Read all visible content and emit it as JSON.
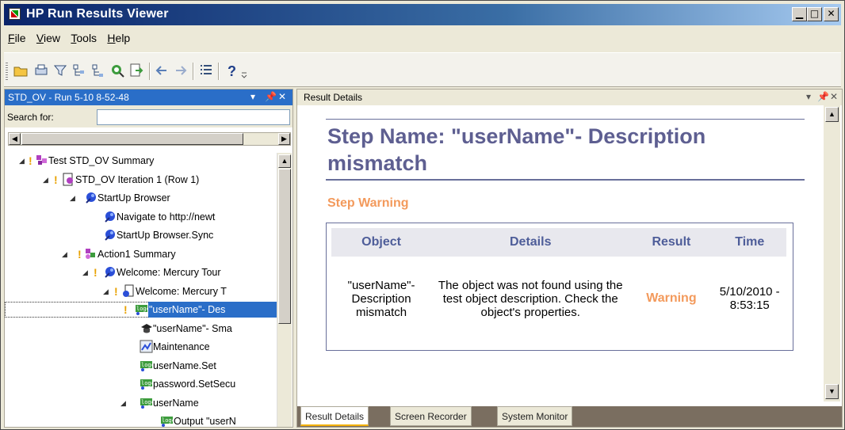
{
  "window": {
    "title": "HP Run Results Viewer",
    "controls": [
      "minimize-icon",
      "maximize-icon",
      "close-icon"
    ]
  },
  "menu": [
    "File",
    "View",
    "Tools",
    "Help"
  ],
  "toolbar": {
    "icons": [
      "open-icon",
      "print-icon",
      "filter-icon",
      "collapse-icon",
      "expand-icon",
      "find-icon",
      "export-icon",
      "back-icon",
      "forward-icon",
      "details-icon",
      "help-icon"
    ]
  },
  "left_pane": {
    "title": "STD_OV - Run 5-10 8-52-48",
    "search_label": "Search for:",
    "search_value": "",
    "tree": [
      {
        "label": "Test STD_OV Summary",
        "icon": "test-summary-icon",
        "expander": "open",
        "warning": true
      },
      {
        "label": "STD_OV Iteration 1 (Row 1)",
        "icon": "iteration-icon",
        "expander": "open",
        "warning": true
      },
      {
        "label": "StartUp Browser",
        "icon": "browser-icon",
        "expander": "open",
        "warning": false
      },
      {
        "label": "Navigate to http://newt",
        "icon": "browser-icon",
        "expander": "",
        "warning": false
      },
      {
        "label": "StartUp Browser.Sync",
        "icon": "browser-icon",
        "expander": "",
        "warning": false
      },
      {
        "label": "Action1 Summary",
        "icon": "action-icon",
        "expander": "open",
        "warning": true
      },
      {
        "label": "Welcome: Mercury Tour",
        "icon": "browser-icon",
        "expander": "open",
        "warning": true
      },
      {
        "label": "Welcome: Mercury T",
        "icon": "page-icon",
        "expander": "open",
        "warning": true
      },
      {
        "label": "\"userName\"- Des",
        "icon": "logic-icon",
        "expander": "",
        "warning": true,
        "selected": true
      },
      {
        "label": "\"userName\"- Sma",
        "icon": "smart-id-icon",
        "expander": "",
        "warning": false
      },
      {
        "label": "Maintenance",
        "icon": "maintenance-icon",
        "expander": "",
        "warning": false
      },
      {
        "label": "userName.Set",
        "icon": "logic-icon",
        "expander": "",
        "warning": false
      },
      {
        "label": "password.SetSecu",
        "icon": "logic-icon",
        "expander": "",
        "warning": false
      },
      {
        "label": "userName",
        "icon": "logic-icon",
        "expander": "open",
        "warning": false
      },
      {
        "label": "Output \"userN",
        "icon": "logic-icon",
        "expander": "",
        "warning": false
      }
    ]
  },
  "right_pane": {
    "title": "Result Details",
    "step_title": "Step Name: \"userName\"- Description mismatch",
    "status": "Step Warning",
    "table": {
      "headers": [
        "Object",
        "Details",
        "Result",
        "Time"
      ],
      "row": {
        "object": "\"userName\"- Description mismatch",
        "details": "The object was not found using the test object description. Check the object's properties.",
        "result": "Warning",
        "time": "5/10/2010 - 8:53:15"
      }
    },
    "tabs": [
      "Result Details",
      "Screen Recorder",
      "System Monitor"
    ],
    "active_tab": "Result Details"
  },
  "colors": {
    "title_bar": "#0a246a",
    "pane_header": "#2a6ec8",
    "heading": "#5e5f91",
    "warning": "#f39a5c",
    "table_header_text": "#4e5d99"
  }
}
